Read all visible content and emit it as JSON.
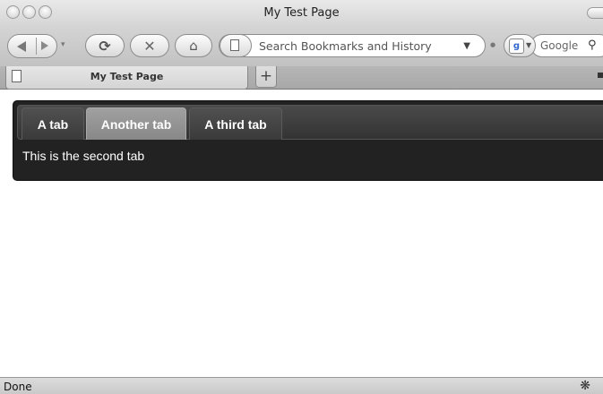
{
  "window": {
    "title": "My Test Page"
  },
  "toolbar": {
    "url_placeholder": "Search Bookmarks and History",
    "search_placeholder": "Google"
  },
  "browser_tabs": [
    {
      "title": "My Test Page"
    }
  ],
  "page": {
    "tabs": [
      {
        "label": "A tab",
        "active": false
      },
      {
        "label": "Another tab",
        "active": true
      },
      {
        "label": "A third tab",
        "active": false
      }
    ],
    "panel_text": "This is the second tab"
  },
  "status": {
    "text": "Done"
  },
  "icons": {
    "back": "back-arrow-icon",
    "forward": "forward-arrow-icon",
    "reload": "reload-icon",
    "stop": "stop-icon",
    "home": "home-icon",
    "page": "page-icon",
    "search_engine": "google-icon",
    "magnifier": "magnifier-icon",
    "firebug": "bug-icon"
  }
}
